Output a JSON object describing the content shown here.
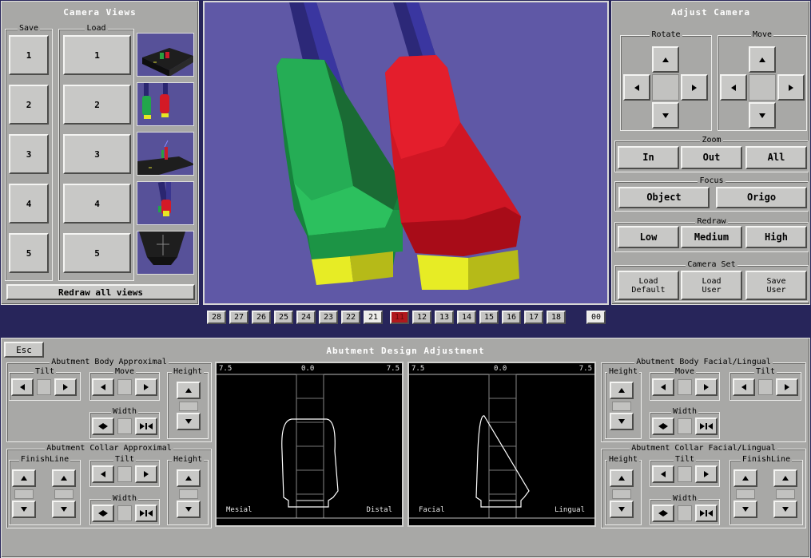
{
  "camera_views": {
    "title": "Camera Views",
    "save_label": "Save",
    "load_label": "Load",
    "save_buttons": [
      "1",
      "2",
      "3",
      "4",
      "5"
    ],
    "load_buttons": [
      "1",
      "2",
      "3",
      "4",
      "5"
    ],
    "redraw_label": "Redraw all views"
  },
  "adjust_camera": {
    "title": "Adjust Camera",
    "rotate_label": "Rotate",
    "move_label": "Move",
    "zoom_label": "Zoom",
    "zoom_buttons": [
      "In",
      "Out",
      "All"
    ],
    "focus_label": "Focus",
    "focus_buttons": [
      "Object",
      "Origo"
    ],
    "redraw_label": "Redraw",
    "redraw_buttons": [
      "Low",
      "Medium",
      "High"
    ],
    "camera_set_label": "Camera Set",
    "camera_set_buttons": [
      {
        "line1": "Load",
        "line2": "Default"
      },
      {
        "line1": "Load",
        "line2": "User"
      },
      {
        "line1": "Save",
        "line2": "User"
      }
    ]
  },
  "tooth_selector": {
    "teeth": [
      "28",
      "27",
      "26",
      "25",
      "24",
      "23",
      "22",
      "21",
      "11",
      "12",
      "13",
      "14",
      "15",
      "16",
      "17",
      "18"
    ],
    "selected": "11",
    "extra": "00"
  },
  "design": {
    "esc_label": "Esc",
    "title": "Abutment Design Adjustment",
    "body_approx": {
      "title": "Abutment Body Approximal",
      "tilt": "Tilt",
      "move": "Move",
      "height": "Height",
      "width": "Width"
    },
    "collar_approx": {
      "title": "Abutment Collar Approximal",
      "finishline": "FinishLine",
      "tilt": "Tilt",
      "height": "Height",
      "width": "Width"
    },
    "body_facial": {
      "title": "Abutment Body Facial/Lingual",
      "height": "Height",
      "move": "Move",
      "tilt": "Tilt",
      "width": "Width"
    },
    "collar_facial": {
      "title": "Abutment Collar Facial/Lingual",
      "height": "Height",
      "tilt": "Tilt",
      "finishline": "FinishLine",
      "width": "Width"
    },
    "left_scope": {
      "left_val": "7.5",
      "center_val": "0.0",
      "right_val": "7.5",
      "left_label": "Mesial",
      "right_label": "Distal"
    },
    "right_scope": {
      "left_val": "7.5",
      "center_val": "0.0",
      "right_val": "7.5",
      "left_label": "Facial",
      "right_label": "Lingual"
    }
  },
  "colors": {
    "panel_bg": "#a8a8a6",
    "viewport_bg": "#5f58a6",
    "selected_tooth": "#b0181c",
    "green_abutment": "#1f9a45",
    "red_abutment": "#d01624"
  }
}
